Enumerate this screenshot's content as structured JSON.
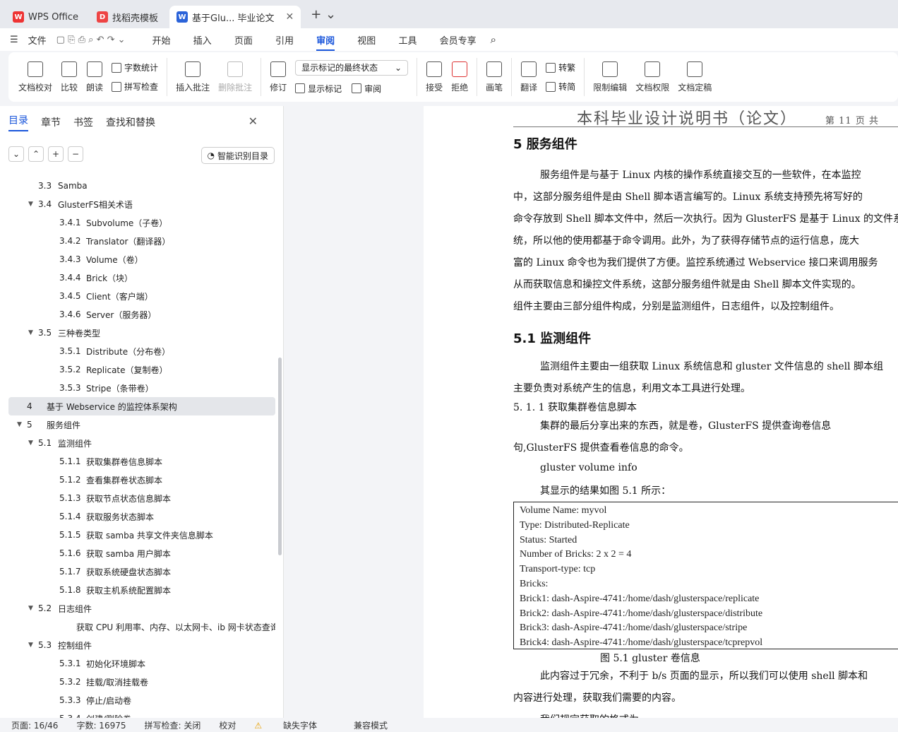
{
  "tabs": [
    {
      "label": "WPS Office"
    },
    {
      "label": "找稻壳模板"
    },
    {
      "label": "基于Glu... 毕业论文"
    }
  ],
  "menu": {
    "file": "文件",
    "tabs": [
      "开始",
      "插入",
      "页面",
      "引用",
      "审阅",
      "视图",
      "工具",
      "会员专享"
    ],
    "active": "审阅"
  },
  "ribbon": {
    "proof": "文档校对",
    "compare": "比较",
    "read": "朗读",
    "wordcount": "字数统计",
    "spell": "拼写检查",
    "insert_comment": "插入批注",
    "delete_comment": "删除批注",
    "track": "修订",
    "markup_state": "显示标记的最终状态",
    "show_markup": "显示标记",
    "review": "审阅",
    "accept": "接受",
    "reject": "拒绝",
    "ink": "画笔",
    "translate": "翻译",
    "to_trad": "转繁",
    "to_simp": "转简",
    "restrict": "限制编辑",
    "permission": "文档权限",
    "finalize": "文档定稿"
  },
  "nav": {
    "tabs": [
      "目录",
      "章节",
      "书签",
      "查找和替换"
    ],
    "smart": "智能识别目录",
    "items": [
      {
        "num": "3.3",
        "text": "Samba",
        "lvl": 2,
        "arrow": ""
      },
      {
        "num": "3.4",
        "text": "GlusterFS相关术语",
        "lvl": 2,
        "arrow": "▼"
      },
      {
        "num": "3.4.1",
        "text": "Subvolume（子卷）",
        "lvl": 3,
        "arrow": ""
      },
      {
        "num": "3.4.2",
        "text": "Translator（翻译器）",
        "lvl": 3,
        "arrow": ""
      },
      {
        "num": "3.4.3",
        "text": "Volume（卷）",
        "lvl": 3,
        "arrow": ""
      },
      {
        "num": "3.4.4",
        "text": "Brick（块）",
        "lvl": 3,
        "arrow": ""
      },
      {
        "num": "3.4.5",
        "text": "Client（客户端）",
        "lvl": 3,
        "arrow": ""
      },
      {
        "num": "3.4.6",
        "text": "Server（服务器）",
        "lvl": 3,
        "arrow": ""
      },
      {
        "num": "3.5",
        "text": "三种卷类型",
        "lvl": 2,
        "arrow": "▼"
      },
      {
        "num": "3.5.1",
        "text": "Distribute（分布卷）",
        "lvl": 3,
        "arrow": ""
      },
      {
        "num": "3.5.2",
        "text": "Replicate（复制卷）",
        "lvl": 3,
        "arrow": ""
      },
      {
        "num": "3.5.3",
        "text": "Stripe（条带卷）",
        "lvl": 3,
        "arrow": ""
      },
      {
        "num": "4",
        "text": "基于 Webservice 的监控体系架构",
        "lvl": 1,
        "arrow": "",
        "sel": true
      },
      {
        "num": "5",
        "text": "服务组件",
        "lvl": 1,
        "arrow": "▼"
      },
      {
        "num": "5.1",
        "text": "监测组件",
        "lvl": 2,
        "arrow": "▼"
      },
      {
        "num": "5.1.1",
        "text": "获取集群卷信息脚本",
        "lvl": 3,
        "arrow": ""
      },
      {
        "num": "5.1.2",
        "text": "查看集群卷状态脚本",
        "lvl": 3,
        "arrow": ""
      },
      {
        "num": "5.1.3",
        "text": "获取节点状态信息脚本",
        "lvl": 3,
        "arrow": ""
      },
      {
        "num": "5.1.4",
        "text": "获取服务状态脚本",
        "lvl": 3,
        "arrow": ""
      },
      {
        "num": "5.1.5",
        "text": "获取 samba 共享文件夹信息脚本",
        "lvl": 3,
        "arrow": ""
      },
      {
        "num": "5.1.6",
        "text": "获取 samba 用户脚本",
        "lvl": 3,
        "arrow": ""
      },
      {
        "num": "5.1.7",
        "text": "获取系统硬盘状态脚本",
        "lvl": 3,
        "arrow": ""
      },
      {
        "num": "5.1.8",
        "text": "获取主机系统配置脚本",
        "lvl": 3,
        "arrow": ""
      },
      {
        "num": "5.2",
        "text": "日志组件",
        "lvl": 2,
        "arrow": "▼"
      },
      {
        "num": "",
        "text": "获取 CPU 利用率、内存、以太网卡、ib 网卡状态查询（...",
        "lvl": 3,
        "arrow": ""
      },
      {
        "num": "5.3",
        "text": "控制组件",
        "lvl": 2,
        "arrow": "▼"
      },
      {
        "num": "5.3.1",
        "text": "初始化环境脚本",
        "lvl": 3,
        "arrow": ""
      },
      {
        "num": "5.3.2",
        "text": "挂载/取消挂载卷",
        "lvl": 3,
        "arrow": ""
      },
      {
        "num": "5.3.3",
        "text": "停止/启动卷",
        "lvl": 3,
        "arrow": ""
      },
      {
        "num": "5.3.4",
        "text": "创建/删除卷",
        "lvl": 3,
        "arrow": ""
      }
    ]
  },
  "doc": {
    "header_title": "本科毕业设计说明书（论文）",
    "header_page": "第 11 页  共",
    "h5": "5      服务组件",
    "p1": [
      "服务组件是与基于 Linux 内核的操作系统直接交互的一些软件，在本监控",
      "中，这部分服务组件是由 Shell 脚本语言编写的。Linux 系统支持预先将写好的",
      "命令存放到 Shell 脚本文件中，然后一次执行。因为 GlusterFS 是基于 Linux 的文件系",
      "统，所以他的使用都基于命令调用。此外，为了获得存储节点的运行信息，庞大",
      "富的 Linux 命令也为我们提供了方便。监控系统通过 Webservice 接口来调用服务",
      "从而获取信息和操控文件系统，这部分服务组件就是由 Shell 脚本文件实现的。",
      "组件主要由三部分组件构成，分别是监测组件，日志组件，以及控制组件。"
    ],
    "h51": "5.1    监测组件",
    "p2": [
      "监测组件主要由一组获取 Linux 系统信息和 gluster 文件信息的 shell 脚本组",
      "主要负责对系统产生的信息，利用文本工具进行处理。"
    ],
    "h511": "5. 1. 1          获取集群卷信息脚本",
    "p3": [
      "集群的最后分享出来的东西，就是卷，GlusterFS 提供查询卷信息",
      "句,GlusterFS 提供查看卷信息的命令。"
    ],
    "cmd": "gluster volume info",
    "p4": "其显示的结果如图 5.1 所示：",
    "box": [
      "Volume Name: myvol",
      "Type: Distributed-Replicate",
      "Status: Started",
      "Number of Bricks: 2 x 2 = 4",
      "Transport-type: tcp",
      "Bricks:",
      "Brick1: dash-Aspire-4741:/home/dash/glusterspace/replicate",
      "Brick2: dash-Aspire-4741:/home/dash/glusterspace/distribute",
      "Brick3: dash-Aspire-4741:/home/dash/glusterspace/stripe",
      "Brick4: dash-Aspire-4741:/home/dash/glusterspace/tcprepvol"
    ],
    "caption": "图  5.1 gluster 卷信息",
    "p5": [
      "此内容过于冗余，不利于 b/s 页面的显示，所以我们可以使用 shell 脚本和",
      "内容进行处理，获取我们需要的内容。"
    ],
    "p6": "我们规定获取的格式为"
  },
  "status": {
    "page": "页面: 16/46",
    "words": "字数: 16975",
    "spell": "拼写检查: 关闭",
    "proof": "校对",
    "font": "缺失字体",
    "compat": "兼容模式"
  }
}
